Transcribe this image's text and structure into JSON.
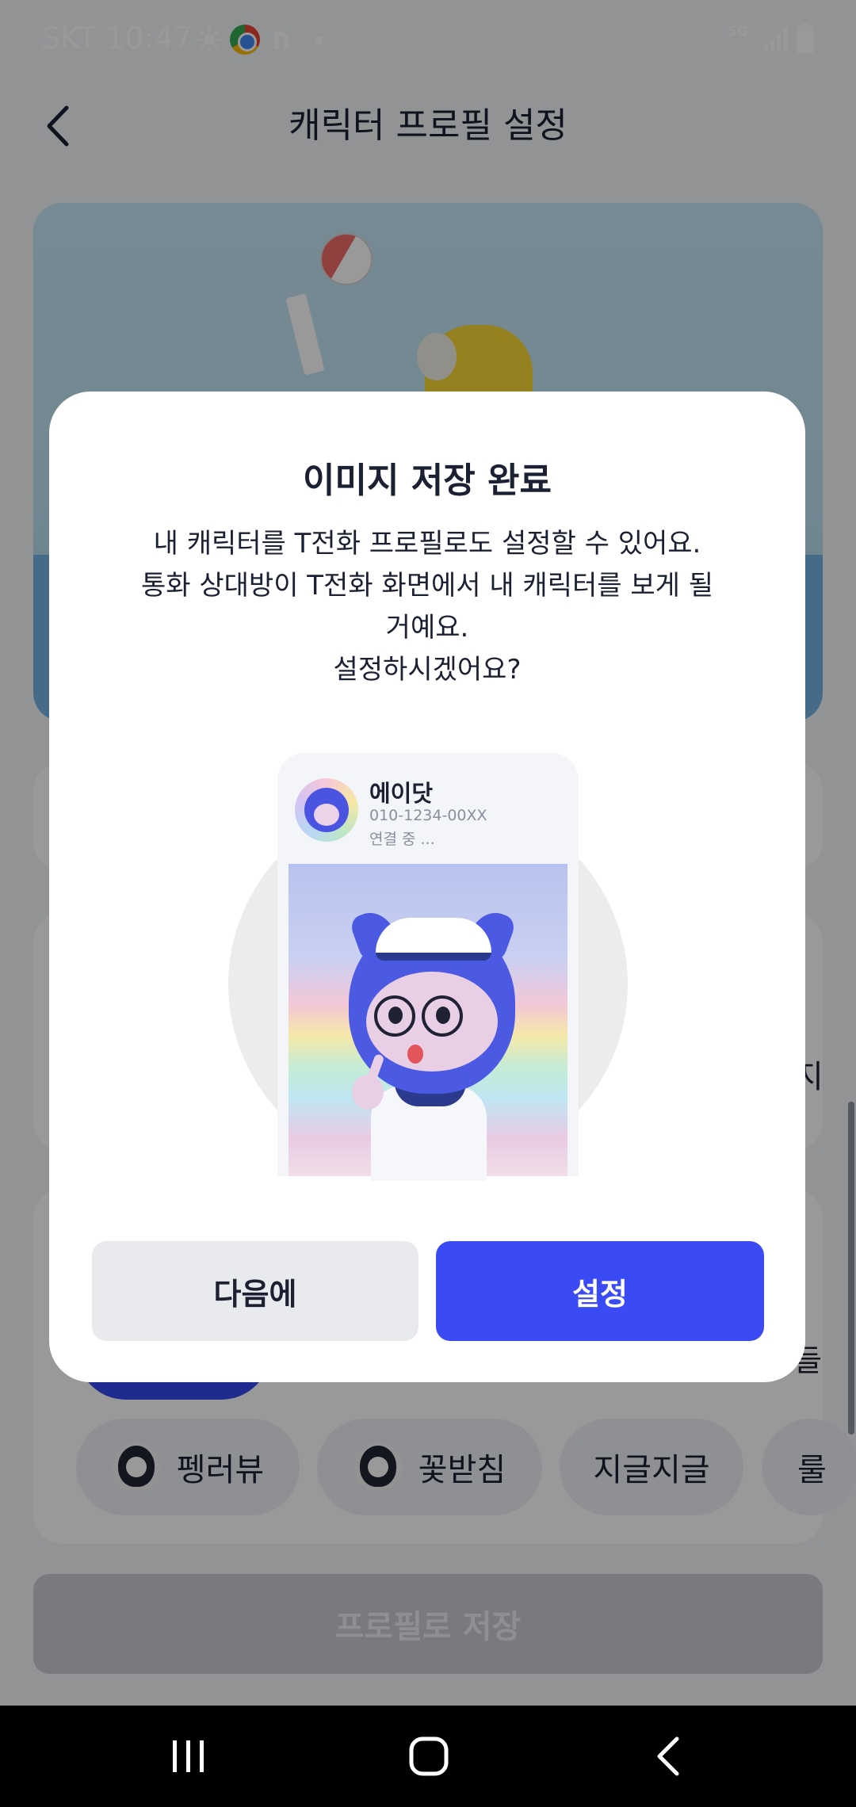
{
  "status_bar": {
    "carrier_time": "SKT 10:47",
    "network": "5G",
    "icons": [
      "sun-icon",
      "chrome-icon",
      "naver-icon",
      "dot-icon",
      "5g-icon",
      "signal-icon",
      "battery-icon"
    ]
  },
  "header": {
    "title": "캐릭터 프로필 설정",
    "back_icon": "back-arrow-icon"
  },
  "background": {
    "side_text_mid": "지",
    "side_text_upper": "들",
    "chips": [
      {
        "label": "펭러뷰",
        "icon": "penguin-avatar-icon"
      },
      {
        "label": "꽃받침",
        "icon": "penguin-avatar-icon"
      },
      {
        "label": "지글지글"
      },
      {
        "label": "룰"
      }
    ],
    "save_button_label": "프로필로 저장"
  },
  "dialog": {
    "title": "이미지 저장 완료",
    "body_lines": [
      "내 캐릭터를 T전화 프로필로도 설정할 수 있어요.",
      "통화 상대방이 T전화 화면에서 내 캐릭터를 보게 될",
      "거예요.",
      "설정하시겠어요?"
    ],
    "preview": {
      "caller_name": "에이닷",
      "caller_number": "010-1234-00XX",
      "caller_status": "연결 중 ..."
    },
    "later_button_label": "다음에",
    "confirm_button_label": "설정"
  },
  "nav_bar": {
    "icons": [
      "recents-icon",
      "home-icon",
      "back-icon"
    ]
  },
  "colors": {
    "accent": "#3A4AF5",
    "dim_overlay": "rgba(0,0,0,0.40)",
    "text_primary": "#1B2033"
  }
}
